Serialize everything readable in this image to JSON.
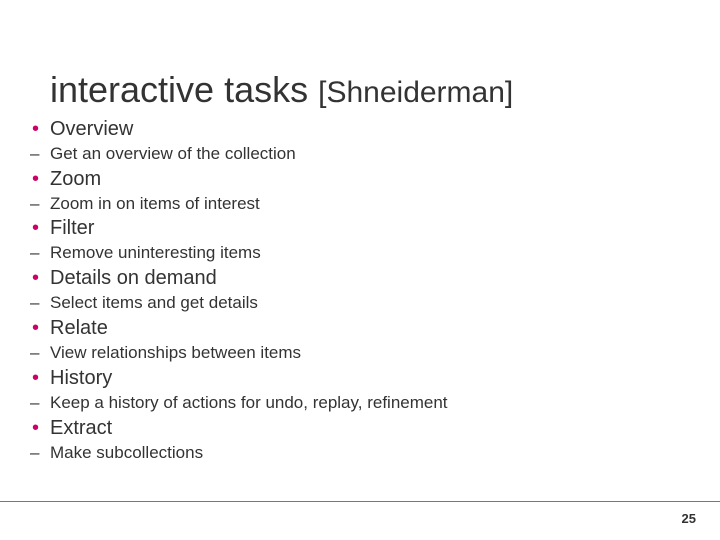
{
  "title_main": "interactive tasks",
  "title_attr": "[Shneiderman]",
  "items": [
    {
      "label": "Overview",
      "desc": "Get an overview of the collection"
    },
    {
      "label": "Zoom",
      "desc": "Zoom in on items of interest"
    },
    {
      "label": "Filter",
      "desc": "Remove uninteresting items"
    },
    {
      "label": "Details on demand",
      "desc": "Select items and get details"
    },
    {
      "label": "Relate",
      "desc": "View relationships between items"
    },
    {
      "label": "History",
      "desc": "Keep a history of actions for undo, replay, refinement"
    },
    {
      "label": "Extract",
      "desc": "Make subcollections"
    }
  ],
  "page_number": "25"
}
